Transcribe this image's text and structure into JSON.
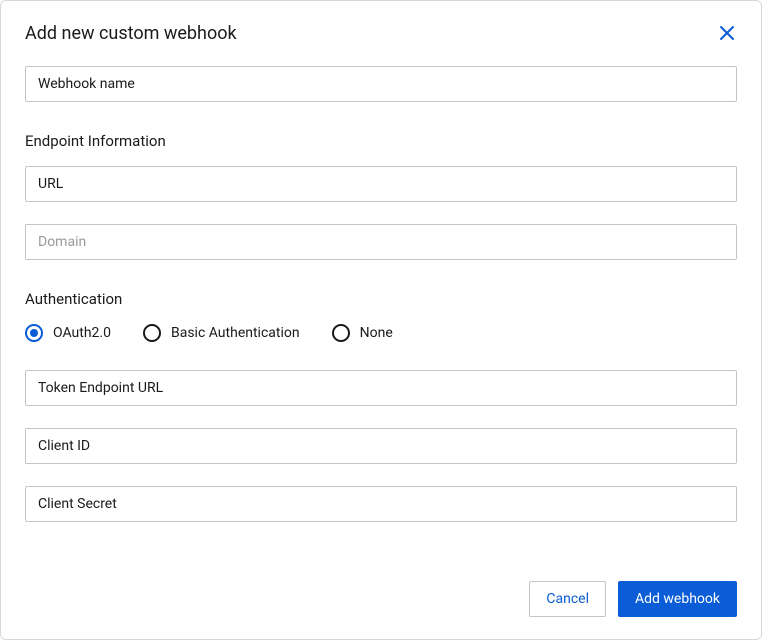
{
  "dialog": {
    "title": "Add new custom webhook"
  },
  "fields": {
    "webhook_name": {
      "label": "Webhook name",
      "value": ""
    },
    "url": {
      "label": "URL",
      "value": ""
    },
    "domain": {
      "placeholder": "Domain",
      "value": ""
    },
    "token_endpoint": {
      "label": "Token Endpoint URL",
      "value": ""
    },
    "client_id": {
      "label": "Client ID",
      "value": ""
    },
    "client_secret": {
      "label": "Client Secret",
      "value": ""
    }
  },
  "sections": {
    "endpoint": "Endpoint Information",
    "auth": "Authentication"
  },
  "auth_options": {
    "oauth": "OAuth2.0",
    "basic": "Basic Authentication",
    "none": "None",
    "selected": "oauth"
  },
  "buttons": {
    "cancel": "Cancel",
    "add": "Add webhook"
  }
}
